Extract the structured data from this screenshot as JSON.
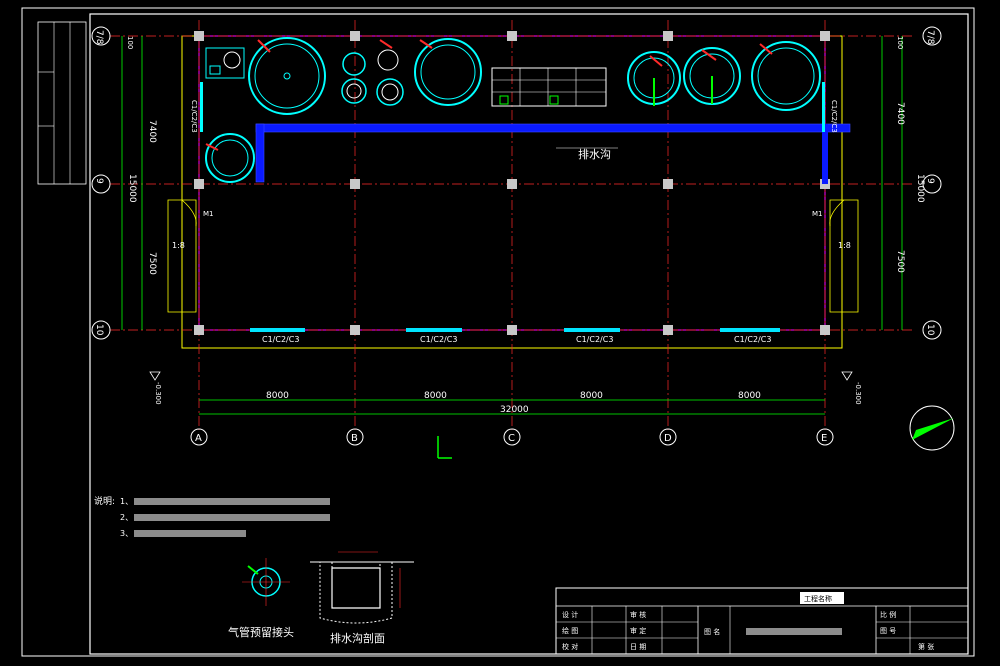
{
  "colors": {
    "background": "#000000",
    "frame": "#ffffff",
    "grid_line": "#ff2a2a",
    "dimension": "#00ff00",
    "wall": "#ffff00",
    "column": "#c8c8c8",
    "equipment": "#00ffff",
    "drain": "#0a1aff",
    "door": "#ff00ff",
    "window": "#00e5ff"
  },
  "grid_axes": {
    "columns": [
      "A",
      "B",
      "C",
      "D",
      "E"
    ],
    "rows": [
      "7",
      "8",
      "9",
      "10"
    ]
  },
  "dimensions": {
    "bay_width": "8000",
    "total_width": "32000",
    "row_top": "7400",
    "row_bottom": "7500",
    "row_total": "15000",
    "small_offset": "100"
  },
  "labels": {
    "drain_channel": "排水沟",
    "window_code": "C1/C2/C3",
    "slope": "1:8",
    "door_left": "M1",
    "door_right": "M1",
    "level": "-0.300"
  },
  "notes": {
    "heading": "说明:",
    "items": [
      "1、",
      "2、",
      "3、"
    ]
  },
  "details": {
    "air_pipe": "气管预留接头",
    "drain_section": "排水沟剖面"
  },
  "title_block": {
    "design": "设 计",
    "drawing": "绘 图",
    "check": "校 对",
    "review": "审 核",
    "approve": "审 定",
    "project": "工程名称",
    "drawing_name_label": "图 名",
    "scale": "比 例",
    "drawing_no": "图 号",
    "date": "日 期",
    "sheet": "第 张"
  }
}
